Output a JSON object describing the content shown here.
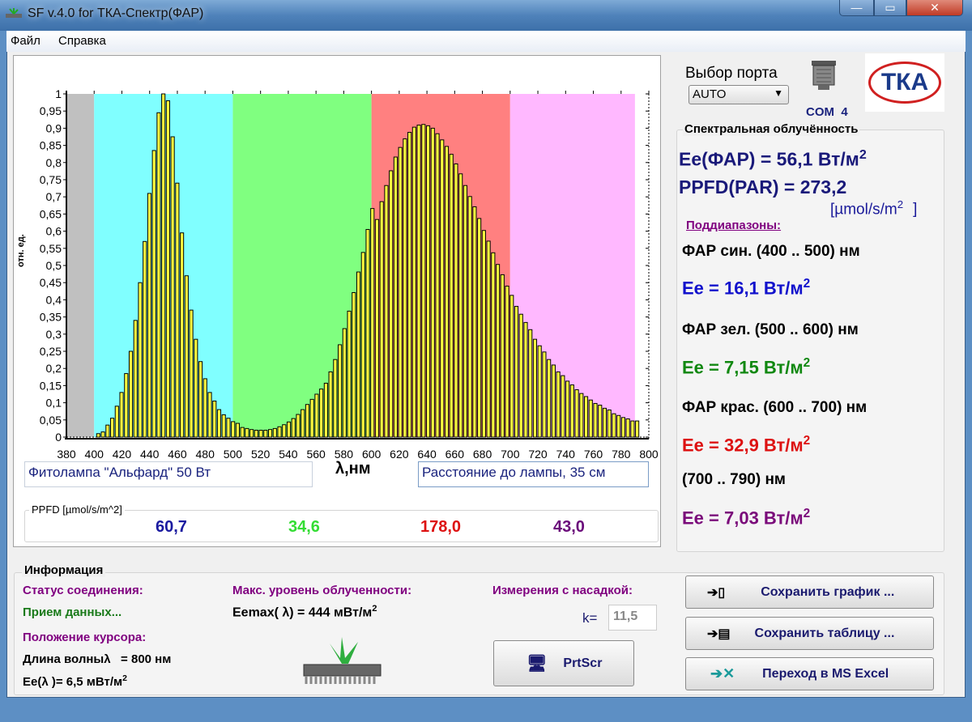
{
  "window": {
    "title": "SF v.4.0 for ТКА-Спектр(ФАР)"
  },
  "menu": {
    "file": "Файл",
    "help": "Справка"
  },
  "chart_data": {
    "type": "bar",
    "ylabel": "отн. ед.",
    "xlabel": "λ,нм",
    "xlim": [
      380,
      800
    ],
    "ylim": [
      0,
      1
    ],
    "x_start": 403,
    "x_step": 3.35,
    "bands": [
      {
        "from": 380,
        "to": 400,
        "color": "#c0c0c0"
      },
      {
        "from": 400,
        "to": 500,
        "color": "#80ffff"
      },
      {
        "from": 500,
        "to": 600,
        "color": "#80ff80"
      },
      {
        "from": 600,
        "to": 700,
        "color": "#ff8080"
      },
      {
        "from": 700,
        "to": 790,
        "color": "#ffb8ff"
      }
    ],
    "bar_color": "#ffff40",
    "values": [
      0.01,
      0.015,
      0.035,
      0.055,
      0.09,
      0.13,
      0.185,
      0.25,
      0.34,
      0.45,
      0.57,
      0.71,
      0.835,
      0.945,
      1.0,
      0.98,
      0.875,
      0.74,
      0.595,
      0.47,
      0.37,
      0.285,
      0.22,
      0.17,
      0.13,
      0.105,
      0.08,
      0.065,
      0.055,
      0.045,
      0.04,
      0.028,
      0.025,
      0.022,
      0.02,
      0.02,
      0.02,
      0.022,
      0.025,
      0.03,
      0.036,
      0.044,
      0.054,
      0.066,
      0.08,
      0.095,
      0.11,
      0.125,
      0.14,
      0.157,
      0.19,
      0.226,
      0.269,
      0.316,
      0.367,
      0.421,
      0.481,
      0.538,
      0.605,
      0.666,
      0.634,
      0.686,
      0.733,
      0.776,
      0.816,
      0.844,
      0.869,
      0.888,
      0.903,
      0.909,
      0.911,
      0.907,
      0.9,
      0.884,
      0.866,
      0.847,
      0.824,
      0.796,
      0.767,
      0.733,
      0.701,
      0.671,
      0.637,
      0.602,
      0.571,
      0.537,
      0.503,
      0.473,
      0.44,
      0.413,
      0.381,
      0.358,
      0.334,
      0.313,
      0.285,
      0.266,
      0.248,
      0.226,
      0.21,
      0.19,
      0.179,
      0.163,
      0.152,
      0.138,
      0.127,
      0.118,
      0.108,
      0.098,
      0.093,
      0.084,
      0.079,
      0.068,
      0.063,
      0.057,
      0.053,
      0.047,
      0.047
    ],
    "xticks": [
      "380",
      "400",
      "420",
      "440",
      "460",
      "480",
      "500",
      "520",
      "540",
      "560",
      "580",
      "600",
      "620",
      "640",
      "660",
      "680",
      "700",
      "720",
      "740",
      "760",
      "780",
      "800"
    ],
    "yticks": [
      "0",
      "0,05",
      "0,1",
      "0,15",
      "0,2",
      "0,25",
      "0,3",
      "0,35",
      "0,4",
      "0,45",
      "0,5",
      "0,55",
      "0,6",
      "0,65",
      "0,7",
      "0,75",
      "0,8",
      "0,85",
      "0,9",
      "0,95",
      "1"
    ]
  },
  "inputs": {
    "lamp": "Фитолампа \"Альфард\" 50 Вт",
    "distance": "Расстояние до лампы, 35 см"
  },
  "ppfd": {
    "title": "PPFD [µmol/s/m^2]",
    "values": [
      {
        "v": "60,7",
        "color": "#1a1aa0"
      },
      {
        "v": "34,6",
        "color": "#33dd33"
      },
      {
        "v": "178,0",
        "color": "#dd1111"
      },
      {
        "v": "43,0",
        "color": "#6a0a7a"
      }
    ]
  },
  "port": {
    "label": "Выбор порта",
    "selected": "AUTO",
    "com": "COM  4"
  },
  "logo": {
    "text": "ТКА"
  },
  "spectral": {
    "title": "Спектральная облучённость",
    "ee_total": "Ee(ФАР) = 56,1 Вт/м",
    "ppfd_total": "PPFD(PAR) = 273,2",
    "ppfd_unit": "[µmol/s/m",
    "ppfd_unit_end": "]",
    "sup2": "2",
    "subranges": "Поддиапазоны:",
    "ranges": [
      {
        "label": "ФАР син. (400 .. 500) нм",
        "value": "Ee = 16,1 Вт/м",
        "color": "#1111cc"
      },
      {
        "label": "ФАР зел. (500 .. 600) нм",
        "value": "Ee = 7,15 Вт/м",
        "color": "#118811"
      },
      {
        "label": "ФАР крас. (600 .. 700) нм",
        "value": "Ee = 32,9 Вт/м",
        "color": "#dd1111"
      },
      {
        "label": "(700 .. 790) нм",
        "value": "Ee = 7,03 Вт/м",
        "color": "#7a0a7a"
      }
    ]
  },
  "info": {
    "title": "Информация",
    "status_label": "Статус соединения:",
    "status_value": "Прием данных...",
    "cursor_label": "Положение курсора:",
    "wavelength": "Длина волныλ   = 800 нм",
    "ee_lambda": "Ee(λ )= 6,5 мВт/м",
    "max_label": "Макс. уровень облученности:",
    "max_value": "Eemax( λ) = 444 мВт/м",
    "nozzle_label": "Измерения с насадкой:",
    "k_label": "k=",
    "k_value": "11,5",
    "prtscr": "PrtScr",
    "save_chart": "Сохранить график ...",
    "save_table": "Сохранить таблицу ...",
    "excel": "Переход в MS Excel"
  }
}
